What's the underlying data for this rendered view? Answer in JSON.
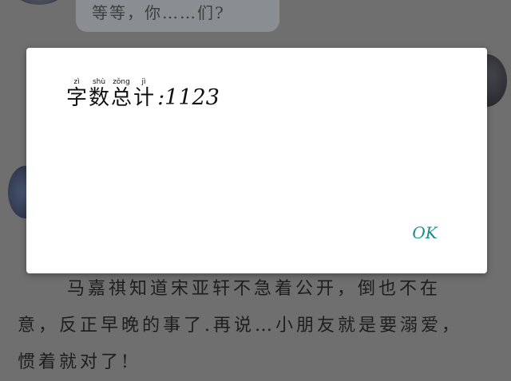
{
  "background": {
    "bubble_text": "等等，你……们?",
    "story_line1": "马嘉祺知道宋亚轩不急着公开，倒也不在",
    "story_line2": "意，反正早晚的事了.再说…小朋友就是要溺爱，",
    "story_line3": "惯着就对了!"
  },
  "dialog": {
    "title_chars": [
      {
        "pinyin": "zì",
        "char": "字"
      },
      {
        "pinyin": "shù",
        "char": "数"
      },
      {
        "pinyin": "zǒng",
        "char": "总"
      },
      {
        "pinyin": "jì",
        "char": "计"
      }
    ],
    "title_value": ":1123",
    "ok_label": "OK"
  },
  "colors": {
    "overlay": "#6f6f6f",
    "ok_accent": "#1a8c8c"
  }
}
